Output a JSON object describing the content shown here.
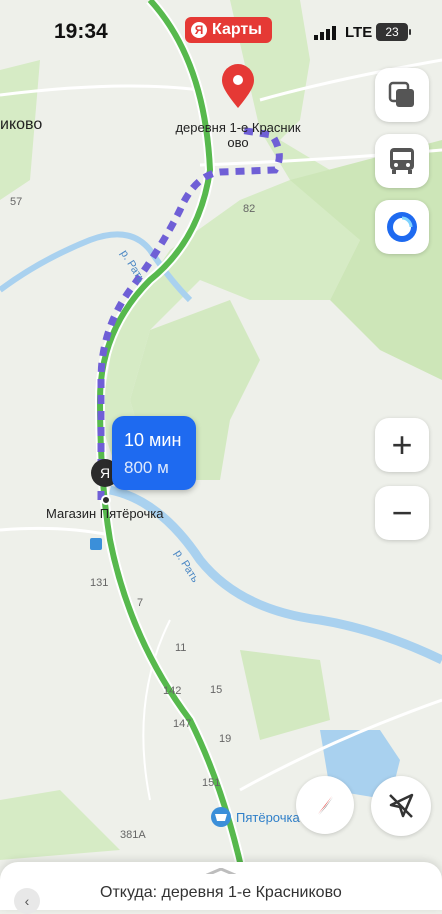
{
  "status_bar": {
    "time": "19:34",
    "network": "LTE",
    "battery": "23"
  },
  "app": {
    "badge_label": "Карты",
    "badge_letter": "Я"
  },
  "map": {
    "destination_label_line1": "деревня 1-е Красник",
    "destination_label_line2": "ово",
    "left_village_label": "иково",
    "store_label": "Магазин Пятёрочка",
    "river_label_1": "р. Рать",
    "river_label_2": "р. Рать",
    "poi_label": "Пятёрочка",
    "house_numbers": [
      "57",
      "82",
      "131",
      "7",
      "11",
      "142",
      "15",
      "147",
      "19",
      "151",
      "381А"
    ]
  },
  "route": {
    "time": "10 мин",
    "distance": "800 м"
  },
  "controls": {
    "layers_icon": "layers-icon",
    "transport_icon": "bus-icon",
    "alice_icon": "alice-icon",
    "zoom_in": "+",
    "zoom_out": "−"
  },
  "bottom_sheet": {
    "from_label": "Откуда: деревня 1-е Красниково"
  },
  "colors": {
    "route": "#6f5fd6",
    "road": "#57b94d",
    "accent": "#1e6af0",
    "pin": "#e53935"
  }
}
